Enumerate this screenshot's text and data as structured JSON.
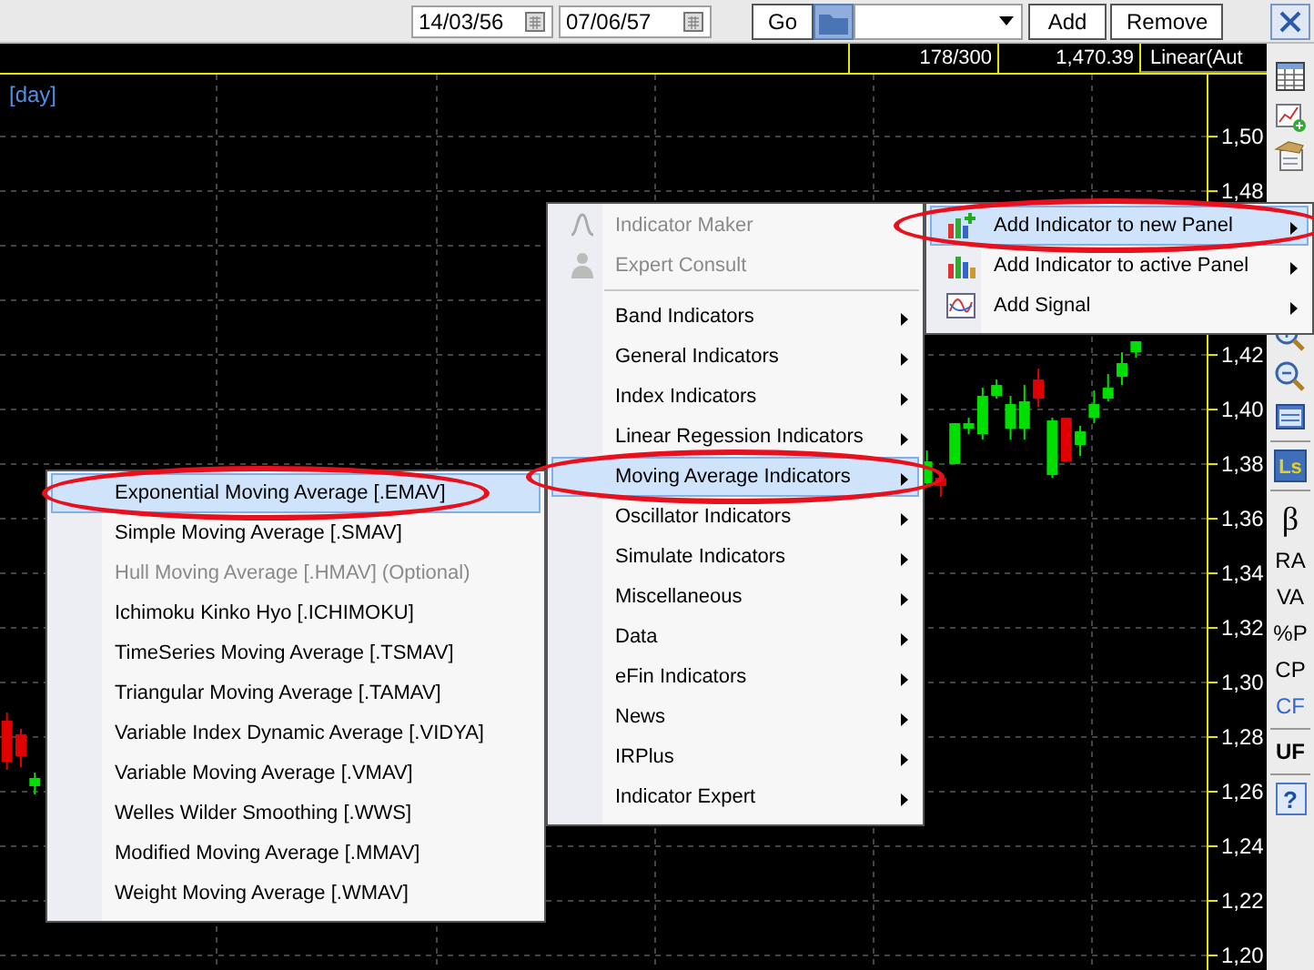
{
  "toolbar": {
    "start_date": "14/03/56",
    "end_date": "07/06/57",
    "go_button": "Go",
    "add_button": "Add",
    "remove_button": "Remove"
  },
  "info_bar": {
    "count": "178/300",
    "price": "1,470.39",
    "scale": "Linear(Aut"
  },
  "chart": {
    "period": "[day]",
    "chart_data": {
      "type": "candlestick",
      "ylim": [
        1.194,
        1.5227
      ],
      "grid": true,
      "yticks": [
        {
          "value": 1.5,
          "label": "1,50"
        },
        {
          "value": 1.48,
          "label": "1,48"
        },
        {
          "value": 1.42,
          "label": "1,42"
        },
        {
          "value": 1.4,
          "label": "1,40"
        },
        {
          "value": 1.38,
          "label": "1,38"
        },
        {
          "value": 1.36,
          "label": "1,36"
        },
        {
          "value": 1.34,
          "label": "1,34"
        },
        {
          "value": 1.32,
          "label": "1,32"
        },
        {
          "value": 1.3,
          "label": "1,30"
        },
        {
          "value": 1.28,
          "label": "1,28"
        },
        {
          "value": 1.26,
          "label": "1,26"
        },
        {
          "value": 1.24,
          "label": "1,24"
        },
        {
          "value": 1.22,
          "label": "1,22"
        },
        {
          "value": 1.2,
          "label": "1,20"
        }
      ],
      "categories": [
        null,
        null,
        null,
        null,
        null,
        null,
        null,
        null,
        null,
        null,
        null,
        null,
        null,
        null,
        null,
        null,
        null,
        null,
        null,
        null,
        null,
        null,
        null,
        null,
        null,
        null,
        null,
        null,
        null,
        null,
        null,
        null,
        null,
        null,
        null,
        null,
        null,
        null,
        null,
        null,
        null,
        null,
        null,
        null,
        null,
        null,
        null,
        null,
        null,
        null,
        null,
        null,
        null,
        null,
        null,
        null,
        null,
        null,
        null,
        null,
        null,
        null,
        null,
        null,
        null,
        null,
        null,
        null,
        null,
        null,
        null,
        null,
        null,
        null,
        null,
        null,
        null,
        null,
        null,
        null,
        null,
        null
      ],
      "ohlc": [
        [
          1.286,
          1.289,
          1.268,
          1.271
        ],
        [
          1.281,
          1.283,
          1.269,
          1.273
        ],
        [
          1.262,
          1.267,
          1.259,
          1.265
        ],
        null,
        null,
        null,
        null,
        null,
        null,
        null,
        null,
        null,
        null,
        null,
        null,
        null,
        null,
        null,
        null,
        null,
        null,
        null,
        null,
        null,
        null,
        null,
        null,
        null,
        null,
        null,
        null,
        null,
        null,
        null,
        null,
        null,
        null,
        null,
        null,
        null,
        null,
        null,
        null,
        null,
        null,
        null,
        null,
        null,
        null,
        null,
        null,
        null,
        null,
        null,
        null,
        null,
        null,
        null,
        null,
        null,
        null,
        null,
        null,
        null,
        null,
        null,
        [
          1.373,
          1.385,
          1.372,
          1.381
        ],
        [
          1.375,
          1.377,
          1.368,
          1.372
        ],
        [
          1.38,
          1.395,
          1.38,
          1.395
        ],
        [
          1.393,
          1.397,
          1.391,
          1.395
        ],
        [
          1.391,
          1.408,
          1.389,
          1.405
        ],
        [
          1.405,
          1.411,
          1.404,
          1.409
        ],
        [
          1.393,
          1.405,
          1.389,
          1.402
        ],
        [
          1.393,
          1.409,
          1.389,
          1.403
        ],
        [
          1.411,
          1.415,
          1.401,
          1.404
        ],
        [
          1.376,
          1.397,
          1.375,
          1.396
        ],
        [
          1.397,
          1.397,
          1.381,
          1.381
        ],
        [
          1.387,
          1.394,
          1.383,
          1.392
        ],
        [
          1.397,
          1.407,
          1.395,
          1.402
        ],
        [
          1.404,
          1.413,
          1.403,
          1.408
        ],
        [
          1.412,
          1.421,
          1.409,
          1.417
        ],
        [
          1.421,
          1.425,
          1.419,
          1.425
        ]
      ]
    }
  },
  "sidebar": {
    "top": [
      {
        "kind": "table"
      },
      {
        "kind": "chart"
      },
      {
        "kind": "hand"
      }
    ],
    "bottom": [
      {
        "kind": "zoomin"
      },
      {
        "kind": "zoomout"
      },
      {
        "kind": "panel"
      },
      {
        "kind": "separator"
      },
      {
        "kind": "badge",
        "label": "Ls"
      },
      {
        "kind": "separator"
      },
      {
        "kind": "symbol",
        "label": "β"
      },
      {
        "kind": "text",
        "label": "RA",
        "color": "#000000"
      },
      {
        "kind": "text",
        "label": "VA",
        "color": "#000000"
      },
      {
        "kind": "text",
        "label": "%P",
        "color": "#000000"
      },
      {
        "kind": "text",
        "label": "CP",
        "color": "#000000"
      },
      {
        "kind": "text",
        "label": "CF",
        "color": "#3366cc"
      },
      {
        "kind": "separator"
      },
      {
        "kind": "strong",
        "label": "UF"
      },
      {
        "kind": "separator"
      },
      {
        "kind": "help",
        "label": "?"
      }
    ]
  },
  "menu": {
    "items": [
      {
        "label": "Indicator Maker",
        "kind": "formula",
        "disabled": true,
        "selected": false,
        "highlighted": false
      },
      {
        "label": "Expert Consult",
        "kind": "expert",
        "disabled": true,
        "selected": false,
        "highlighted": false
      },
      {
        "label": "Band Indicators",
        "kind": "submenu",
        "disabled": false,
        "selected": false,
        "highlighted": false
      },
      {
        "label": "General Indicators",
        "kind": "submenu",
        "disabled": false,
        "selected": false,
        "highlighted": false
      },
      {
        "label": "Index Indicators",
        "kind": "submenu",
        "disabled": false,
        "selected": false,
        "highlighted": false
      },
      {
        "label": "Linear Regession Indicators",
        "kind": "submenu",
        "disabled": false,
        "selected": false,
        "highlighted": false
      },
      {
        "label": "Moving Average Indicators",
        "kind": "submenu",
        "disabled": false,
        "selected": true,
        "highlighted": true
      },
      {
        "label": "Oscillator Indicators",
        "kind": "submenu",
        "disabled": false,
        "selected": false,
        "highlighted": false
      },
      {
        "label": "Simulate Indicators",
        "kind": "submenu",
        "disabled": false,
        "selected": false,
        "highlighted": false
      },
      {
        "label": "Miscellaneous",
        "kind": "submenu",
        "disabled": false,
        "selected": false,
        "highlighted": false
      },
      {
        "label": "Data",
        "kind": "submenu",
        "disabled": false,
        "selected": false,
        "highlighted": false
      },
      {
        "label": "eFin Indicators",
        "kind": "submenu",
        "disabled": false,
        "selected": false,
        "highlighted": false
      },
      {
        "label": "News",
        "kind": "submenu",
        "disabled": false,
        "selected": false,
        "highlighted": false
      },
      {
        "label": "IRPlus",
        "kind": "submenu",
        "disabled": false,
        "selected": false,
        "highlighted": false
      },
      {
        "label": "Indicator Expert",
        "kind": "submenu",
        "disabled": false,
        "selected": false,
        "highlighted": false
      }
    ]
  },
  "panel_menu": {
    "items": [
      {
        "label": "Add Indicator to new Panel",
        "kind": "newpanel",
        "disabled": false,
        "selected": true,
        "highlighted": true
      },
      {
        "label": "Add Indicator to active Panel",
        "kind": "activepanel",
        "disabled": false,
        "selected": false,
        "highlighted": false
      },
      {
        "label": "Add Signal",
        "kind": "signal",
        "disabled": false,
        "selected": false,
        "highlighted": false
      }
    ]
  },
  "moving_average_menu": {
    "items": [
      {
        "label": "Exponential Moving Average [.EMAV]",
        "disabled": false,
        "selected": true,
        "highlighted": true
      },
      {
        "label": "Simple Moving Average [.SMAV]",
        "disabled": false,
        "selected": false,
        "highlighted": false
      },
      {
        "label": "Hull Moving Average [.HMAV] (Optional)",
        "disabled": true,
        "selected": false,
        "highlighted": false
      },
      {
        "label": "Ichimoku Kinko Hyo [.ICHIMOKU]",
        "disabled": false,
        "selected": false,
        "highlighted": false
      },
      {
        "label": "TimeSeries Moving Average [.TSMAV]",
        "disabled": false,
        "selected": false,
        "highlighted": false
      },
      {
        "label": "Triangular Moving Average [.TAMAV]",
        "disabled": false,
        "selected": false,
        "highlighted": false
      },
      {
        "label": "Variable Index Dynamic Average [.VIDYA]",
        "disabled": false,
        "selected": false,
        "highlighted": false
      },
      {
        "label": "Variable Moving Average [.VMAV]",
        "disabled": false,
        "selected": false,
        "highlighted": false
      },
      {
        "label": "Welles Wilder Smoothing [.WWS]",
        "disabled": false,
        "selected": false,
        "highlighted": false
      },
      {
        "label": "Modified Moving Average [.MMAV]",
        "disabled": false,
        "selected": false,
        "highlighted": false
      },
      {
        "label": "Weight Moving Average [.WMAV]",
        "disabled": false,
        "selected": false,
        "highlighted": false
      }
    ]
  }
}
